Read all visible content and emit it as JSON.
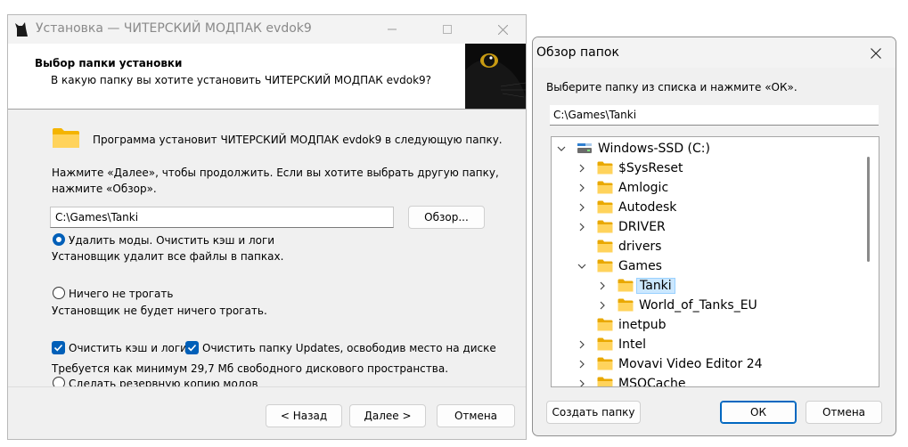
{
  "installer": {
    "title": "Установка — ЧИТЕРСКИЙ МОДПАК evdok9",
    "header_title": "Выбор папки установки",
    "header_subtitle": "В какую папку вы хотите установить ЧИТЕРСКИЙ МОДПАК evdok9?",
    "install_line": "Программа установит ЧИТЕРСКИЙ МОДПАК evdok9 в следующую папку.",
    "instruction_1": "Нажмите «Далее», чтобы продолжить. Если вы хотите выбрать другую папку,",
    "instruction_2": "нажмите «Обзор».",
    "path_value": "C:\\Games\\Tanki",
    "browse_label": "Обзор...",
    "option_delete_label": "Удалить моды. Очистить кэш и логи",
    "option_delete_desc": "Установщик удалит все файлы в папках.",
    "option_keep_label": "Ничего не трогать",
    "option_keep_desc": "Установщик не будет ничего трогать.",
    "check_cache_label": "Очистить кэш и логи",
    "check_updates_label": "Очистить папку Updates, освободив место на диске",
    "space_required": "Требуется как минимум 29,7 Мб свободного дискового пространства.",
    "option_backup_label": "Сделать резервную копию модов",
    "back_label": "< Назад",
    "next_label": "Далее >",
    "cancel_label": "Отмена"
  },
  "browse_dialog": {
    "title": "Обзор папок",
    "instruction": "Выберите папку из списка и нажмите «ОК».",
    "path_value": "C:\\Games\\Tanki",
    "tree": [
      {
        "label": "Windows-SSD (C:)",
        "icon": "drive-icon",
        "expanded": true,
        "selected": false
      },
      {
        "label": "$SysReset",
        "icon": "folder-icon",
        "expanded": false,
        "selected": false
      },
      {
        "label": "Amlogic",
        "icon": "folder-icon",
        "expanded": false,
        "selected": false
      },
      {
        "label": "Autodesk",
        "icon": "folder-icon",
        "expanded": false,
        "selected": false
      },
      {
        "label": "DRIVER",
        "icon": "folder-icon",
        "expanded": false,
        "selected": false
      },
      {
        "label": "drivers",
        "icon": "folder-icon",
        "expanded": false,
        "selected": false
      },
      {
        "label": "Games",
        "icon": "folder-icon",
        "expanded": true,
        "selected": false
      },
      {
        "label": "Tanki",
        "icon": "folder-icon",
        "expanded": false,
        "selected": true
      },
      {
        "label": "World_of_Tanks_EU",
        "icon": "folder-icon",
        "expanded": false,
        "selected": false
      },
      {
        "label": "inetpub",
        "icon": "folder-icon",
        "expanded": false,
        "selected": false
      },
      {
        "label": "Intel",
        "icon": "folder-icon",
        "expanded": false,
        "selected": false
      },
      {
        "label": "Movavi Video Editor 24",
        "icon": "folder-icon",
        "expanded": false,
        "selected": false
      },
      {
        "label": "MSOCache",
        "icon": "folder-icon",
        "expanded": false,
        "selected": false
      }
    ],
    "create_folder_label": "Создать папку",
    "ok_label": "ОК",
    "cancel_label": "Отмена"
  },
  "colors": {
    "accent": "#005fb8",
    "folder_yellow": "#ffd35c",
    "selection": "#cce8ff"
  }
}
